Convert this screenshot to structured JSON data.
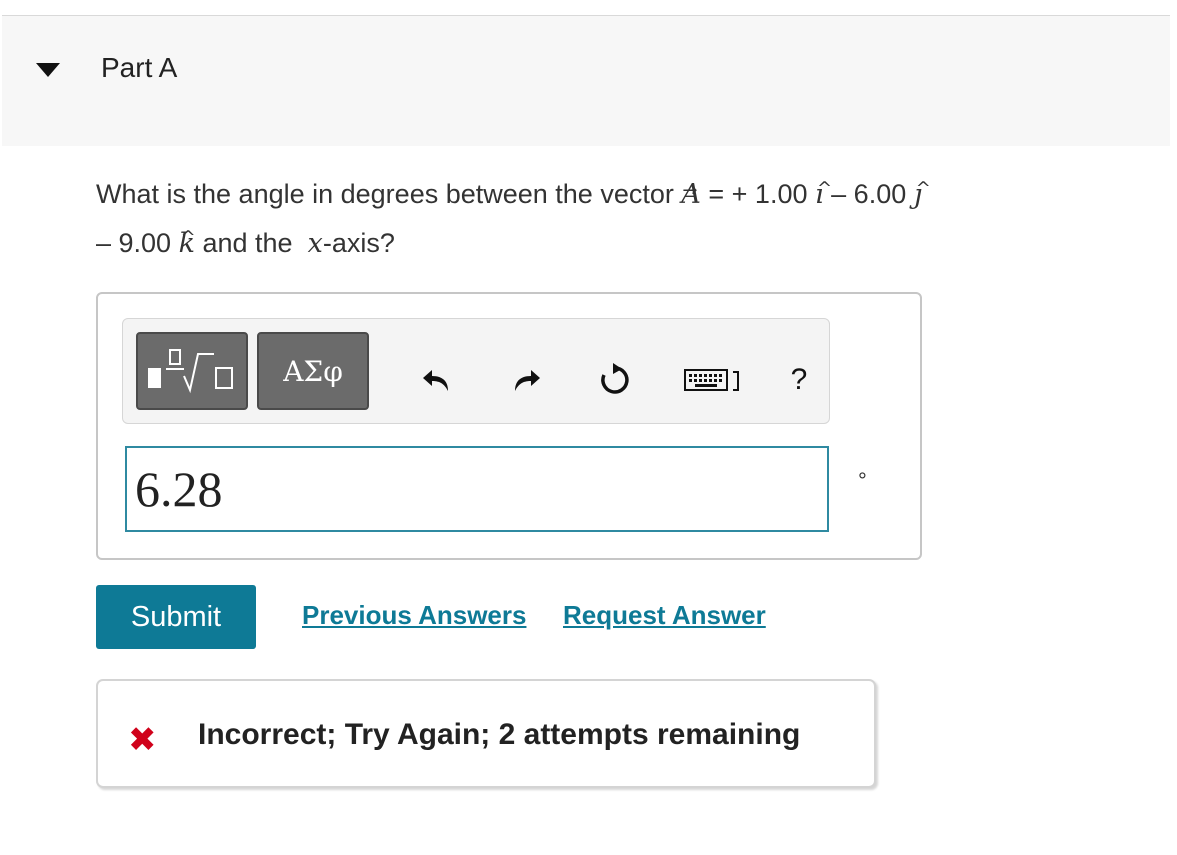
{
  "part": {
    "title": "Part A"
  },
  "question": {
    "prefix": "What is the angle in degrees between the vector",
    "vector": "A",
    "vector_arrow": "→",
    "eq": "= + 1.00",
    "i": "ı",
    "hat": "^",
    "minus1": "– 6.00",
    "j": "ȷ",
    "minus2": "– 9.00",
    "k": "k",
    "middle": "and the",
    "axis_var": "x",
    "suffix": "-axis?"
  },
  "toolbar": {
    "symbols_label": "ΑΣφ",
    "help_label": "?"
  },
  "answer": {
    "value": "6.28",
    "unit": "°"
  },
  "actions": {
    "submit_label": "Submit",
    "previous_label": "Previous Answers",
    "request_label": "Request Answer"
  },
  "feedback": {
    "icon": "✖",
    "text": "Incorrect; Try Again; 2 attempts remaining"
  },
  "colors": {
    "accent": "#0e7a96",
    "error": "#d0021b"
  }
}
